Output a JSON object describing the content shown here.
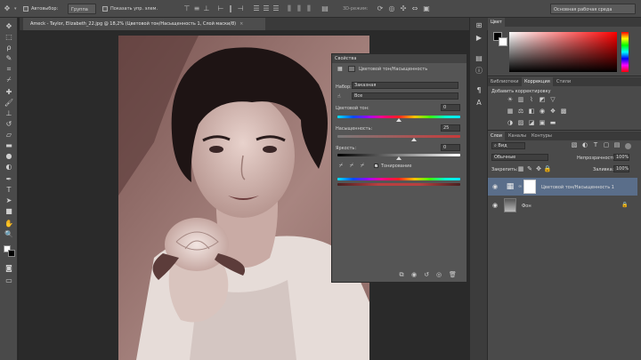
{
  "options_bar": {
    "auto_select_label": "Автовыбор:",
    "auto_select_value": "Группа",
    "show_transform_label": "Показать упр. элем.",
    "mode_3d_label": "3D-режим:",
    "workspace": "Основная рабочая среда"
  },
  "document": {
    "tab_title": "Ameck - Taylor, Elizabeth_22.jpg @ 18,2% (Цветовой тон/Насыщенность 1, Слой маски/8)"
  },
  "properties": {
    "panel_title": "Свойства",
    "adjustment_name": "Цветовой тон/Насыщенность",
    "preset_label": "Набор:",
    "preset_value": "Заказная",
    "channel_value": "Все",
    "hue_label": "Цветовой тон:",
    "hue_value": "0",
    "saturation_label": "Насыщенность:",
    "saturation_value": "25",
    "lightness_label": "Яркость:",
    "lightness_value": "0",
    "colorize_label": "Тонирование",
    "colorize_checked": true,
    "hue_norm": 0.0,
    "saturation_norm": 0.25,
    "lightness_norm": 0.0
  },
  "color_panel": {
    "tab_label": "Цвет",
    "foreground": "#000000",
    "background": "#ffffff"
  },
  "adjustments_panel": {
    "tabs": [
      "Библиотеки",
      "Коррекция",
      "Стили"
    ],
    "active_tab": "Коррекция",
    "title": "Добавить корректировку"
  },
  "layers_panel": {
    "tabs": [
      "Слои",
      "Каналы",
      "Контуры"
    ],
    "filter_kind": "Вид",
    "blend_mode": "Обычные",
    "opacity_label": "Непрозрачность:",
    "opacity_value": "100%",
    "lock_label": "Закрепить:",
    "fill_label": "Заливка:",
    "fill_value": "100%",
    "layers": [
      {
        "name": "Цветовой тон/Насыщенность 1",
        "selected": true
      },
      {
        "name": "Фон",
        "selected": false
      }
    ]
  },
  "icons": {
    "tools": [
      "move-icon",
      "marquee-icon",
      "lasso-icon",
      "quick-select-icon",
      "crop-icon",
      "eyedropper-icon",
      "healing-icon",
      "brush-icon",
      "clone-stamp-icon",
      "history-brush-icon",
      "eraser-icon",
      "gradient-icon",
      "blur-icon",
      "dodge-icon",
      "pen-icon",
      "type-icon",
      "path-select-icon",
      "shape-icon",
      "hand-icon",
      "zoom-icon"
    ]
  }
}
